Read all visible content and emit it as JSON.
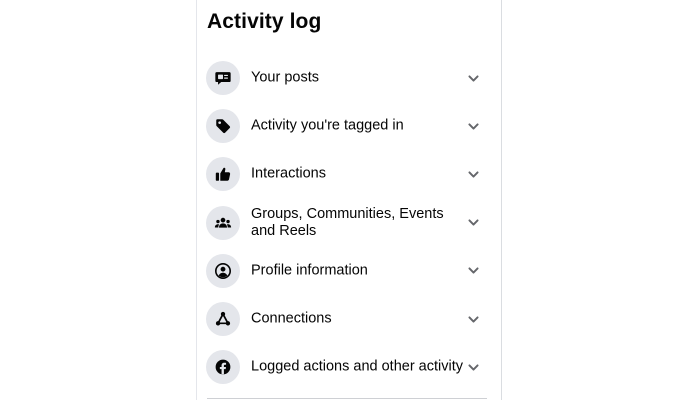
{
  "header": {
    "title": "Activity log"
  },
  "menu": {
    "items": [
      {
        "label": "Your posts",
        "icon": "speech-bubble-icon"
      },
      {
        "label": "Activity you're tagged in",
        "icon": "tag-icon"
      },
      {
        "label": "Interactions",
        "icon": "thumbs-up-icon"
      },
      {
        "label": "Groups, Communities, Events and Reels",
        "icon": "people-icon"
      },
      {
        "label": "Profile information",
        "icon": "profile-icon"
      },
      {
        "label": "Connections",
        "icon": "connections-icon"
      },
      {
        "label": "Logged actions and other activity",
        "icon": "facebook-logo-icon"
      }
    ],
    "expand_icon": "chevron-down-icon"
  },
  "colors": {
    "text": "#050505",
    "icon_bg": "#e4e6eb",
    "icon_fg": "#050505",
    "chevron": "#65676b",
    "divider": "#ced0d4"
  }
}
